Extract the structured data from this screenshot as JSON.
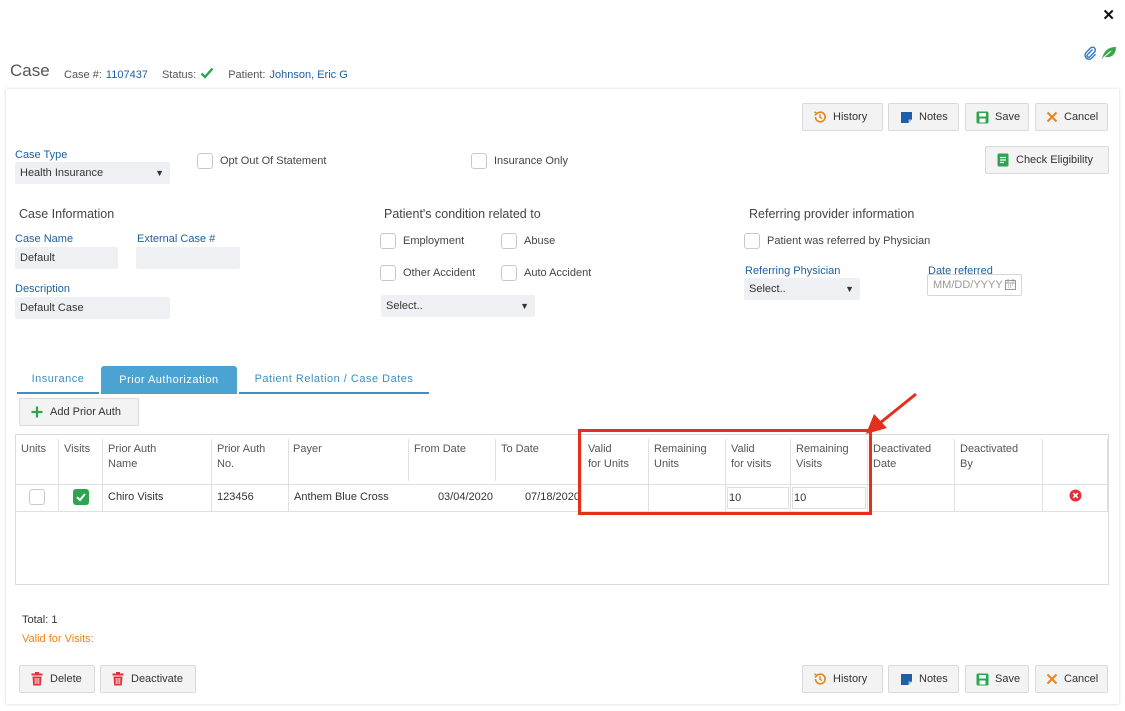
{
  "window": {
    "close_glyph": "✕"
  },
  "header": {
    "title": "Case",
    "case_no_label": "Case #:",
    "case_no": "1107437",
    "status_label": "Status:",
    "patient_label": "Patient:",
    "patient_name": "Johnson, Eric G",
    "icons": [
      "paperclip-icon",
      "leaf-icon"
    ]
  },
  "toolbar": {
    "history": "History",
    "notes": "Notes",
    "save": "Save",
    "cancel": "Cancel",
    "check_eligibility": "Check Eligibility"
  },
  "form": {
    "case_type_label": "Case Type",
    "case_type_value": "Health Insurance",
    "opt_out_label": "Opt Out Of Statement",
    "insurance_only_label": "Insurance Only",
    "case_info_title": "Case Information",
    "case_name_label": "Case Name",
    "case_name_value": "Default",
    "external_case_label": "External Case #",
    "external_case_value": "",
    "description_label": "Description",
    "description_value": "Default Case",
    "condition_title": "Patient's condition related to",
    "employment": "Employment",
    "abuse": "Abuse",
    "other_accident": "Other Accident",
    "auto_accident": "Auto Accident",
    "condition_select": "Select..",
    "referring_title": "Referring provider information",
    "referred_by_physician": "Patient was referred by Physician",
    "referring_physician_label": "Referring Physician",
    "referring_physician_value": "Select..",
    "date_referred_label": "Date referred",
    "date_referred_placeholder": "MM/DD/YYYY"
  },
  "tabs": [
    "Insurance",
    "Prior Authorization",
    "Patient Relation / Case Dates"
  ],
  "add_prior_auth": "Add Prior Auth",
  "table": {
    "headers": {
      "units": "Units",
      "visits": "Visits",
      "pa_name_1": "Prior Auth",
      "pa_name_2": "Name",
      "pa_no_1": "Prior Auth",
      "pa_no_2": "No.",
      "payer": "Payer",
      "from_date": "From Date",
      "to_date": "To Date",
      "valid_units_1": "Valid",
      "valid_units_2": "for Units",
      "rem_units_1": "Remaining",
      "rem_units_2": "Units",
      "valid_visits_1": "Valid",
      "valid_visits_2": "for visits",
      "rem_visits_1": "Remaining",
      "rem_visits_2": "Visits",
      "deact_date_1": "Deactivated",
      "deact_date_2": "Date",
      "deact_by_1": "Deactivated",
      "deact_by_2": "By"
    },
    "rows": [
      {
        "units_checked": false,
        "visits_checked": true,
        "name": "Chiro Visits",
        "number": "123456",
        "payer": "Anthem Blue Cross",
        "from_date": "03/04/2020",
        "to_date": "07/18/2020",
        "valid_units": "",
        "remaining_units": "",
        "valid_visits": "10",
        "remaining_visits": "10",
        "deactivated_date": "",
        "deactivated_by": ""
      }
    ]
  },
  "footer": {
    "total": "Total: 1",
    "valid_for_visits": "Valid for Visits:",
    "delete": "Delete",
    "deactivate": "Deactivate"
  },
  "colors": {
    "accent_blue": "#4aa3d1",
    "link_blue": "#1f5e9c",
    "green": "#2ea44f",
    "red": "#e2301c",
    "orange": "#e8841c"
  }
}
